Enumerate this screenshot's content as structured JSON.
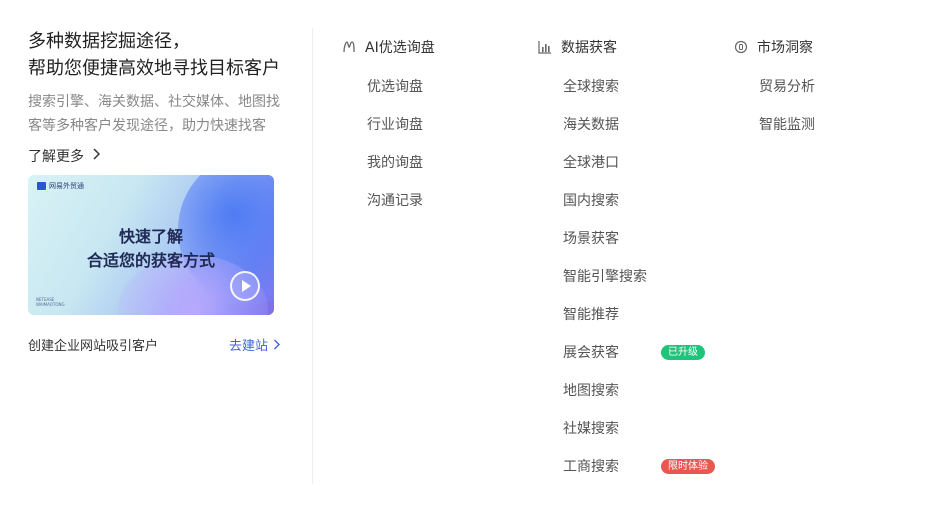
{
  "intro": {
    "heading_line1": "多种数据挖掘途径，",
    "heading_line2": "帮助您便捷高效地寻找目标客户",
    "description": "搜索引擎、海关数据、社交媒体、地图找客等多种客户发现途径，助力快速找客",
    "more_label": "了解更多"
  },
  "banner": {
    "logo_text": "网易外贸通",
    "title_line1": "快速了解",
    "title_line2": "合适您的获客方式",
    "small_text_line1": "NETEASE",
    "small_text_line2": "WAIMAOTONG"
  },
  "site": {
    "label": "创建企业网站吸引客户",
    "link": "去建站"
  },
  "columns": [
    {
      "title": "AI优选询盘",
      "icon": "ai-inquiry-icon",
      "items": [
        {
          "label": "优选询盘"
        },
        {
          "label": "行业询盘"
        },
        {
          "label": "我的询盘"
        },
        {
          "label": "沟通记录"
        }
      ]
    },
    {
      "title": "数据获客",
      "icon": "bar-chart-icon",
      "items": [
        {
          "label": "全球搜索"
        },
        {
          "label": "海关数据"
        },
        {
          "label": "全球港口"
        },
        {
          "label": "国内搜索"
        },
        {
          "label": "场景获客"
        },
        {
          "label": "智能引擎搜索"
        },
        {
          "label": "智能推荐"
        },
        {
          "label": "展会获客",
          "badge": "已升级",
          "badge_color": "#1fc47b"
        },
        {
          "label": "地图搜索"
        },
        {
          "label": "社媒搜索"
        },
        {
          "label": "工商搜索",
          "badge": "限时体验",
          "badge_color": "#e9584f"
        }
      ]
    },
    {
      "title": "市场洞察",
      "icon": "insight-icon",
      "items": [
        {
          "label": "贸易分析"
        },
        {
          "label": "智能监测"
        }
      ]
    }
  ],
  "colors": {
    "link": "#3b66d6",
    "badge_green": "#1fc47b",
    "badge_red": "#e9584f"
  }
}
